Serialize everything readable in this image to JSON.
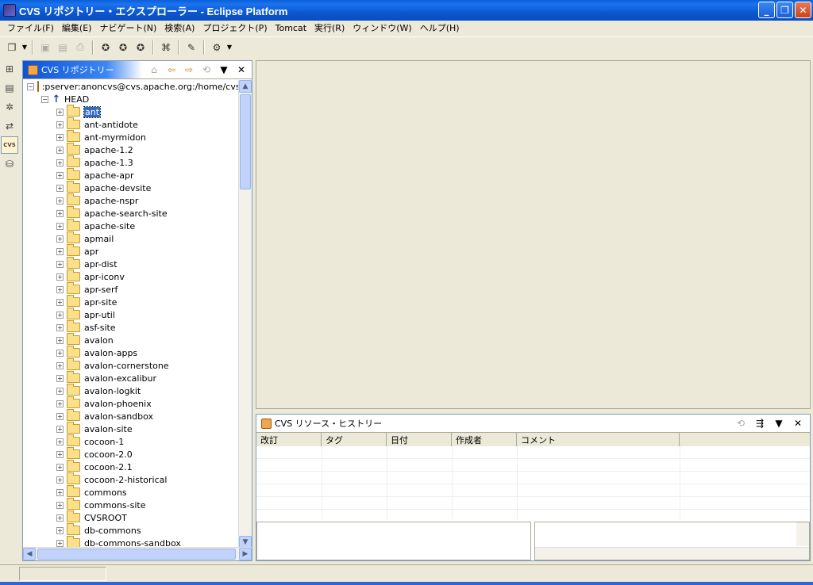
{
  "window": {
    "title": "CVS リポジトリー・エクスプローラー - Eclipse Platform"
  },
  "menu": [
    "ファイル(F)",
    "編集(E)",
    "ナビゲート(N)",
    "検索(A)",
    "プロジェクト(P)",
    "Tomcat",
    "実行(R)",
    "ウィンドウ(W)",
    "ヘルプ(H)"
  ],
  "repo_view": {
    "tab_label": "CVS リポジトリー",
    "repository": ":pserver:anoncvs@cvs.apache.org:/home/cvsp",
    "head": "HEAD",
    "selected_module": "ant",
    "modules": [
      "ant-antidote",
      "ant-myrmidon",
      "apache-1.2",
      "apache-1.3",
      "apache-apr",
      "apache-devsite",
      "apache-nspr",
      "apache-search-site",
      "apache-site",
      "apmail",
      "apr",
      "apr-dist",
      "apr-iconv",
      "apr-serf",
      "apr-site",
      "apr-util",
      "asf-site",
      "avalon",
      "avalon-apps",
      "avalon-cornerstone",
      "avalon-excalibur",
      "avalon-logkit",
      "avalon-phoenix",
      "avalon-sandbox",
      "avalon-site",
      "cocoon-1",
      "cocoon-2.0",
      "cocoon-2.1",
      "cocoon-2-historical",
      "commons",
      "commons-site",
      "CVSROOT",
      "db-commons",
      "db-commons-sandbox"
    ]
  },
  "history_view": {
    "tab_label": "CVS リソース・ヒストリー",
    "columns": [
      "改訂",
      "タグ",
      "日付",
      "作成者",
      "コメント"
    ]
  },
  "colors": {
    "accent": "#316ac5",
    "titlebar": "#0a5fd8"
  }
}
